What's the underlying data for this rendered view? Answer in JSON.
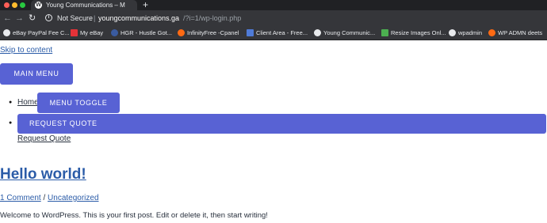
{
  "browser": {
    "tab_title": "Young Communications – My W",
    "tab_favicon": "wordpress-icon",
    "new_tab": "+",
    "close": "×",
    "security_label": "Not Secure",
    "separator": "|",
    "url_host": "youngcommunications.ga",
    "url_path": "/?i=1/wp-login.php",
    "bookmarks": [
      {
        "label": "eBay PayPal Fee C...",
        "icon": "globe-icon",
        "color": "#e8eaed"
      },
      {
        "label": "My eBay",
        "icon": "ebay-icon",
        "color": "#e53238"
      },
      {
        "label": "HGR - Hustle Got...",
        "icon": "hgr-icon",
        "color": "#3a5ba0"
      },
      {
        "label": "InfinityFree -Cpanel",
        "icon": "infinityfree-icon",
        "color": "#ff6a13"
      },
      {
        "label": "Client Area - Free...",
        "icon": "client-area-icon",
        "color": "#4f7bd8"
      },
      {
        "label": "Young Communic...",
        "icon": "wordpress-icon",
        "color": "#e8eaed"
      },
      {
        "label": "Resize Images Onl...",
        "icon": "resize-icon",
        "color": "#4caf50"
      },
      {
        "label": "wpadmin",
        "icon": "wordpress-icon",
        "color": "#e8eaed"
      },
      {
        "label": "WP ADMN deets",
        "icon": "infinityfree-icon",
        "color": "#ff6a13"
      }
    ]
  },
  "page": {
    "skip_link": "Skip to content",
    "main_menu": "MAIN MENU",
    "menu_toggle": "MENU TOGGLE",
    "home_link": "Home",
    "request_quote_button": "REQUEST QUOTE",
    "request_quote_link": "Request Quote",
    "post_title": "Hello world!",
    "comments_link": "1 Comment",
    "meta_separator": " / ",
    "category_link": "Uncategorized",
    "excerpt": "Welcome to WordPress. This is your first post. Edit or delete it, then start writing!",
    "accent_color": "#5862d4"
  }
}
